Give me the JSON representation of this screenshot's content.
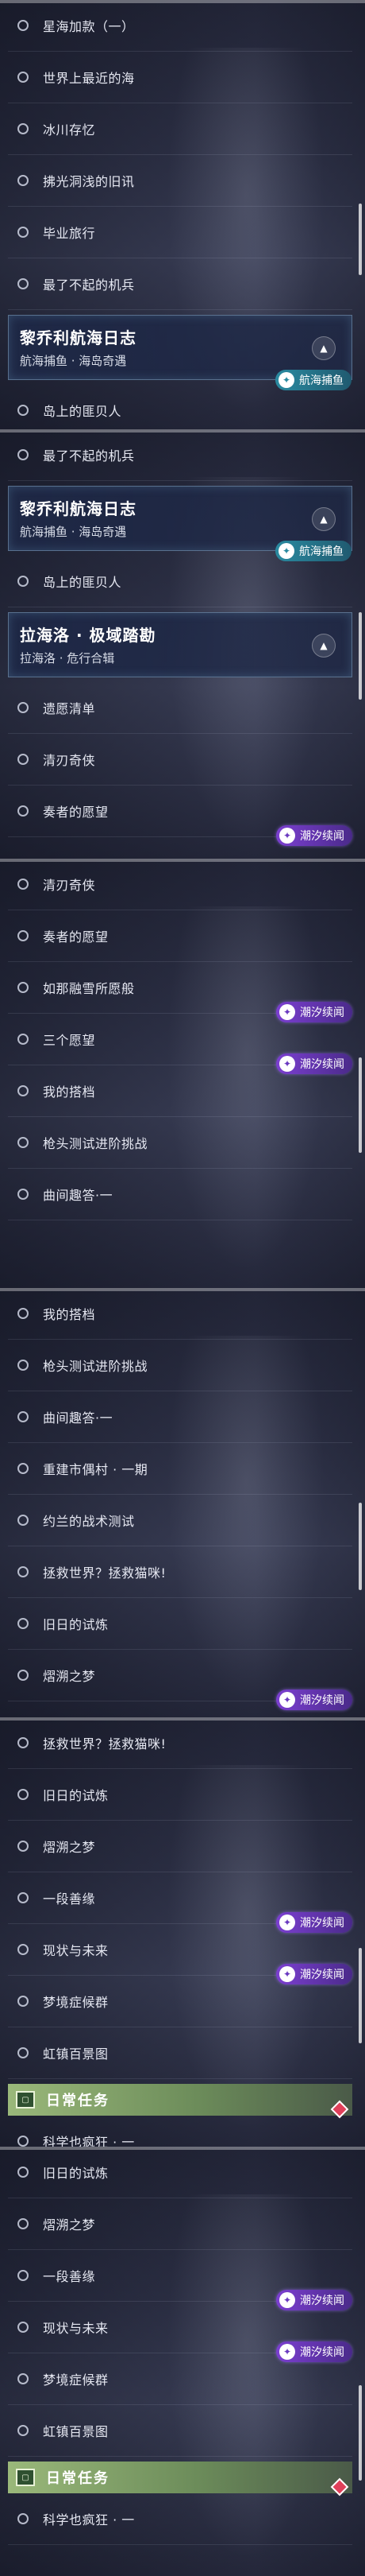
{
  "tag_icon": "✦",
  "header_toggle_icon": "▲",
  "daily_icon": "▢",
  "shots": [
    {
      "rows": [
        {
          "type": "item",
          "label": "星海加款（一）"
        },
        {
          "type": "item",
          "label": "世界上最近的海"
        },
        {
          "type": "item",
          "label": "冰川存忆"
        },
        {
          "type": "item",
          "label": "拂光洞浅的旧讯"
        },
        {
          "type": "item",
          "label": "毕业旅行"
        },
        {
          "type": "item",
          "label": "最了不起的机兵"
        },
        {
          "type": "header",
          "title": "黎乔利航海日志",
          "subtitle": "航海捕鱼 · 海岛奇遇",
          "tag": "航海捕鱼",
          "tag_color": "cyan"
        },
        {
          "type": "item",
          "label": "岛上的匪贝人"
        }
      ]
    },
    {
      "rows": [
        {
          "type": "item",
          "label": "最了不起的机兵"
        },
        {
          "type": "header",
          "title": "黎乔利航海日志",
          "subtitle": "航海捕鱼 · 海岛奇遇",
          "tag": "航海捕鱼",
          "tag_color": "cyan"
        },
        {
          "type": "item",
          "label": "岛上的匪贝人"
        },
        {
          "type": "header",
          "title": "拉海洛 · 极域踏勘",
          "subtitle": "拉海洛 · 危行合辑"
        },
        {
          "type": "item",
          "label": "遗愿清单"
        },
        {
          "type": "item",
          "label": "清刃奇侠"
        },
        {
          "type": "item",
          "label": "奏者的愿望",
          "tag": "潮汐续闻"
        }
      ]
    },
    {
      "rows": [
        {
          "type": "item",
          "label": "清刃奇侠"
        },
        {
          "type": "item",
          "label": "奏者的愿望"
        },
        {
          "type": "item",
          "label": "如那融雪所愿般",
          "tag": "潮汐续闻"
        },
        {
          "type": "item",
          "label": "三个愿望",
          "tag": "潮汐续闻"
        },
        {
          "type": "item",
          "label": "我的搭档"
        },
        {
          "type": "item",
          "label": "枪头测试进阶挑战"
        },
        {
          "type": "item",
          "label": "曲间趣答·一"
        }
      ]
    },
    {
      "rows": [
        {
          "type": "item",
          "label": "我的搭档"
        },
        {
          "type": "item",
          "label": "枪头测试进阶挑战"
        },
        {
          "type": "item",
          "label": "曲间趣答·一"
        },
        {
          "type": "item",
          "label": "重建市偶村 · 一期"
        },
        {
          "type": "item",
          "label": "约兰的战术测试"
        },
        {
          "type": "item",
          "label": "拯救世界？拯救猫咪!"
        },
        {
          "type": "item",
          "label": "旧日的试炼"
        },
        {
          "type": "item",
          "label": "熠溯之梦",
          "tag": "潮汐续闻"
        }
      ]
    },
    {
      "rows": [
        {
          "type": "item",
          "label": "拯救世界？拯救猫咪!"
        },
        {
          "type": "item",
          "label": "旧日的试炼"
        },
        {
          "type": "item",
          "label": "熠溯之梦"
        },
        {
          "type": "item",
          "label": "一段善缘",
          "tag": "潮汐续闻"
        },
        {
          "type": "item",
          "label": "现状与未来",
          "tag": "潮汐续闻"
        },
        {
          "type": "item",
          "label": "梦境症候群"
        },
        {
          "type": "item",
          "label": "虹镇百景图"
        },
        {
          "type": "daily",
          "label": "日常任务"
        },
        {
          "type": "item",
          "label": "科学也疯狂 · 一"
        }
      ]
    },
    {
      "rows": [
        {
          "type": "item",
          "label": "旧日的试炼"
        },
        {
          "type": "item",
          "label": "熠溯之梦"
        },
        {
          "type": "item",
          "label": "一段善缘",
          "tag": "潮汐续闻"
        },
        {
          "type": "item",
          "label": "现状与未来",
          "tag": "潮汐续闻"
        },
        {
          "type": "item",
          "label": "梦境症候群"
        },
        {
          "type": "item",
          "label": "虹镇百景图"
        },
        {
          "type": "daily",
          "label": "日常任务"
        },
        {
          "type": "item",
          "label": "科学也疯狂 · 一"
        }
      ]
    }
  ]
}
